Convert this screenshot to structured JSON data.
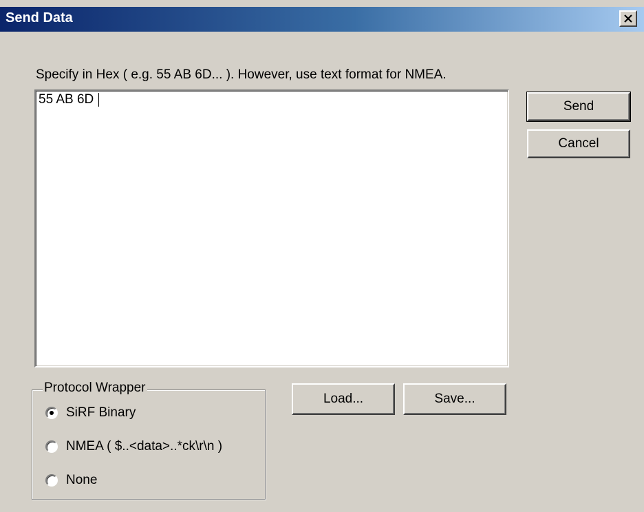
{
  "window": {
    "title": "Send Data"
  },
  "instruction": "Specify in Hex ( e.g. 55 AB 6D... ).  However, use text format for NMEA.",
  "data_field": {
    "value": "55 AB 6D "
  },
  "buttons": {
    "send": "Send",
    "cancel": "Cancel",
    "load": "Load...",
    "save": "Save..."
  },
  "protocol_wrapper": {
    "label": "Protocol Wrapper",
    "options": [
      {
        "label": "SiRF Binary",
        "selected": true
      },
      {
        "label": "NMEA ( $..<data>..*ck\\r\\n )",
        "selected": false
      },
      {
        "label": "None",
        "selected": false
      }
    ]
  }
}
